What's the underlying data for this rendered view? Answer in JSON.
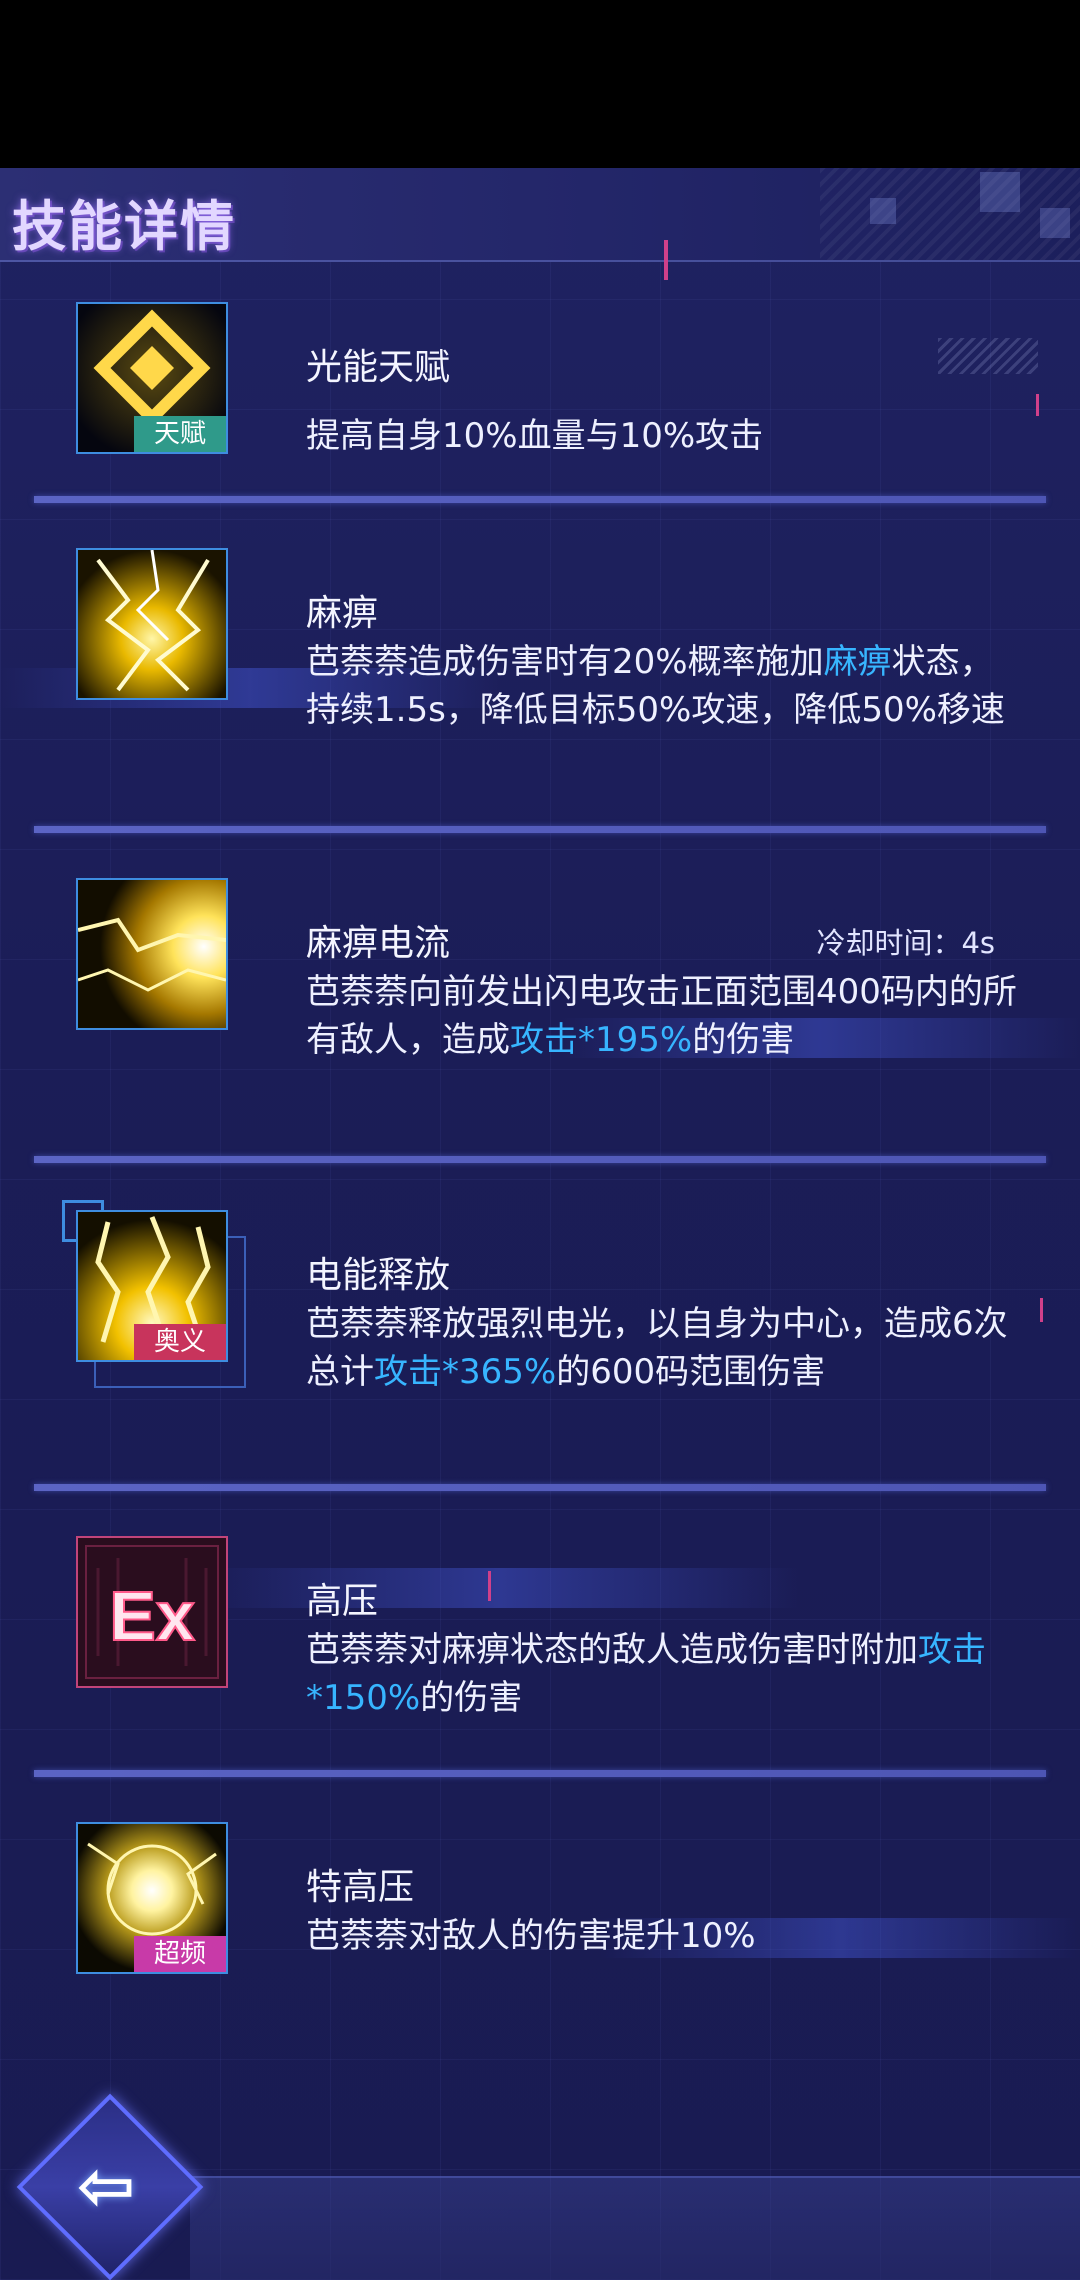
{
  "header": {
    "title": "技能详情"
  },
  "skills": [
    {
      "name": "光能天赋",
      "badge": "天赋",
      "desc": [
        {
          "t": "提高自身10%血量与10%攻击"
        }
      ]
    },
    {
      "name": "麻痹",
      "desc": [
        {
          "t": "芭萘萘造成伤害时有20%概率施加"
        },
        {
          "t": "麻痹",
          "hl": true
        },
        {
          "t": "状态，持续1.5s，降低目标50%攻速，降低50%移速"
        }
      ]
    },
    {
      "name": "麻痹电流",
      "cooldown": "冷却时间：4s",
      "desc": [
        {
          "t": "芭萘萘向前发出闪电攻击正面范围400码内的所有敌人，造成"
        },
        {
          "t": "攻击*195%",
          "hl": true
        },
        {
          "t": "的伤害"
        }
      ]
    },
    {
      "name": "电能释放",
      "badge": "奥义",
      "desc": [
        {
          "t": "芭萘萘释放强烈电光，以自身为中心，造成6次总计"
        },
        {
          "t": "攻击*365%",
          "hl": true
        },
        {
          "t": "的600码范围伤害"
        }
      ]
    },
    {
      "name": "高压",
      "icon_text": "Ex",
      "desc": [
        {
          "t": "芭萘萘对麻痹状态的敌人造成伤害时附加"
        },
        {
          "t": "攻击*150%",
          "hl": true
        },
        {
          "t": "的伤害"
        }
      ]
    },
    {
      "name": "特高压",
      "badge": "超频",
      "desc": [
        {
          "t": "芭萘萘对敌人的伤害提升10%"
        }
      ]
    }
  ],
  "colors": {
    "highlight": "#37b5ff",
    "badge_talent": "#2f9a8a",
    "badge_ultimate": "#c8345c",
    "badge_overclock": "#c83aa8"
  },
  "back_icon": "back-arrow-icon"
}
